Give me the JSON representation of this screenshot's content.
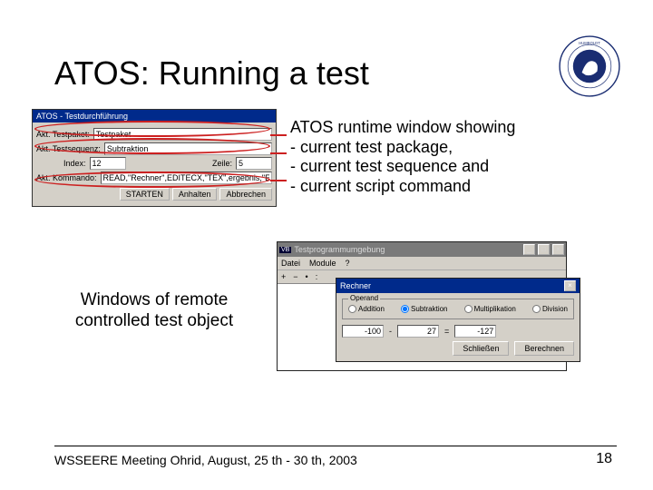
{
  "title": "ATOS: Running a test",
  "desc": {
    "l1": "ATOS runtime window showing",
    "l2": "- current test package,",
    "l3": "- current test sequence and",
    "l4": "- current script command"
  },
  "atos": {
    "title": "ATOS - Testdurchführung",
    "lbl_pkg": "Akt. Testpaket:",
    "val_pkg": "Testpaket",
    "lbl_seq": "Akt. Testsequenz:",
    "val_seq": "Subtraktion",
    "lbl_idx": "Index:",
    "val_idx": "12",
    "lbl_line": "Zeile:",
    "val_line": "5",
    "lbl_cmd": "Akt. Kommando:",
    "val_cmd": "READ,\"Rechner\",EDITECX,\"TEX\",ergebnis,\"Ec\"",
    "btn_start": "STARTEN",
    "btn_pause": "Anhalten",
    "btn_abort": "Abbrechen"
  },
  "remote_label": {
    "l1": "Windows of remote",
    "l2": "controlled test object"
  },
  "ide": {
    "title": "Testprogrammumgebung",
    "menu_file": "Datei",
    "menu_module": "Module",
    "menu_help": "?",
    "tool_plus": "+",
    "tool_minus": "−",
    "tool_dot": "•",
    "tool_colon": ":"
  },
  "calc": {
    "title": "Rechner",
    "group": "Operand",
    "r_add": "Addition",
    "r_sub": "Subtraktion",
    "r_mul": "Multiplikation",
    "r_div": "Division",
    "in_a": "-100",
    "in_b": "27",
    "in_r": "-127",
    "op": "-",
    "eq": "=",
    "btn_close": "Schließen",
    "btn_calc": "Berechnen"
  },
  "footer": {
    "left": "WSSEERE Meeting Ohrid, August, 25 th - 30 th, 2003",
    "page": "18"
  }
}
